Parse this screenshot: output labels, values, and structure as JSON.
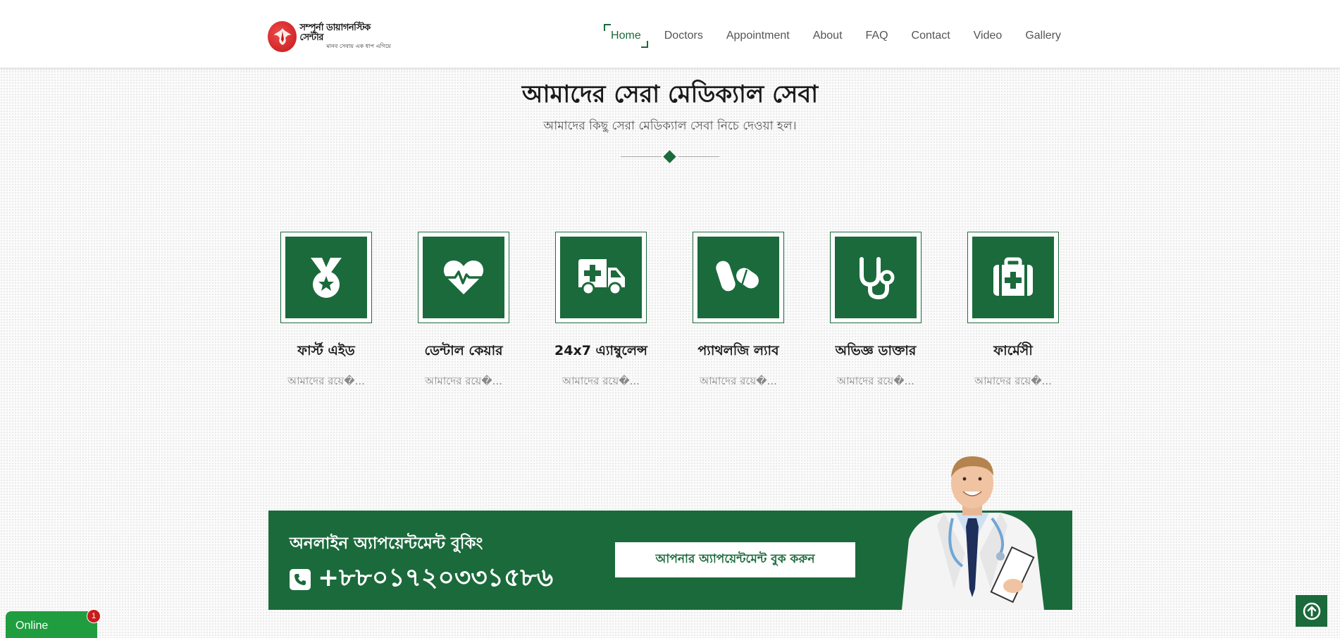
{
  "header": {
    "logo": {
      "name": "সম্পূর্না ডায়াগনস্টিক সেন্টার",
      "tagline": "মানব সেবায় এক ধাপ এগিয়ে"
    },
    "nav": [
      {
        "label": "Home",
        "active": true
      },
      {
        "label": "Doctors"
      },
      {
        "label": "Appointment"
      },
      {
        "label": "About"
      },
      {
        "label": "FAQ"
      },
      {
        "label": "Contact"
      },
      {
        "label": "Video"
      },
      {
        "label": "Gallery"
      }
    ]
  },
  "services_section": {
    "title": "আমাদের সেরা মেডিক্যাল সেবা",
    "subtitle": "আমাদের কিছু সেরা মেডিক্যাল সেবা নিচে দেওয়া হল।",
    "items": [
      {
        "icon": "medal-icon",
        "name": "ফার্স্ট এইড",
        "desc": "আমাদের রয়ে�..."
      },
      {
        "icon": "heart-pulse-icon",
        "name": "ডেন্টাল কেয়ার",
        "desc": "আমাদের রয়ে�..."
      },
      {
        "icon": "ambulance-icon",
        "name": "24x7 এ্যাম্বুলেন্স",
        "desc": "আমাদের রয়ে�..."
      },
      {
        "icon": "pills-icon",
        "name": "প্যাথলজি ল্যাব",
        "desc": "আমাদের রয়ে�..."
      },
      {
        "icon": "stethoscope-icon",
        "name": "অভিজ্ঞ ডাক্তার",
        "desc": "আমাদের রয়ে�..."
      },
      {
        "icon": "medkit-icon",
        "name": "ফার্মেসী",
        "desc": "আমাদের রয়ে�..."
      }
    ]
  },
  "banner": {
    "title": "অনলাইন অ্যাপয়েন্টমেন্ট বুকিং",
    "phone": "+৮৮০১৭২০৩৩১৫৮৬",
    "button": "আপনার অ্যাপয়েন্টমেন্ট বুক করুন"
  },
  "chat": {
    "label": "Online",
    "badge": "1"
  },
  "colors": {
    "primary": "#1b6a3b",
    "chat": "#1f9d3f",
    "badge": "#c81d1d"
  }
}
